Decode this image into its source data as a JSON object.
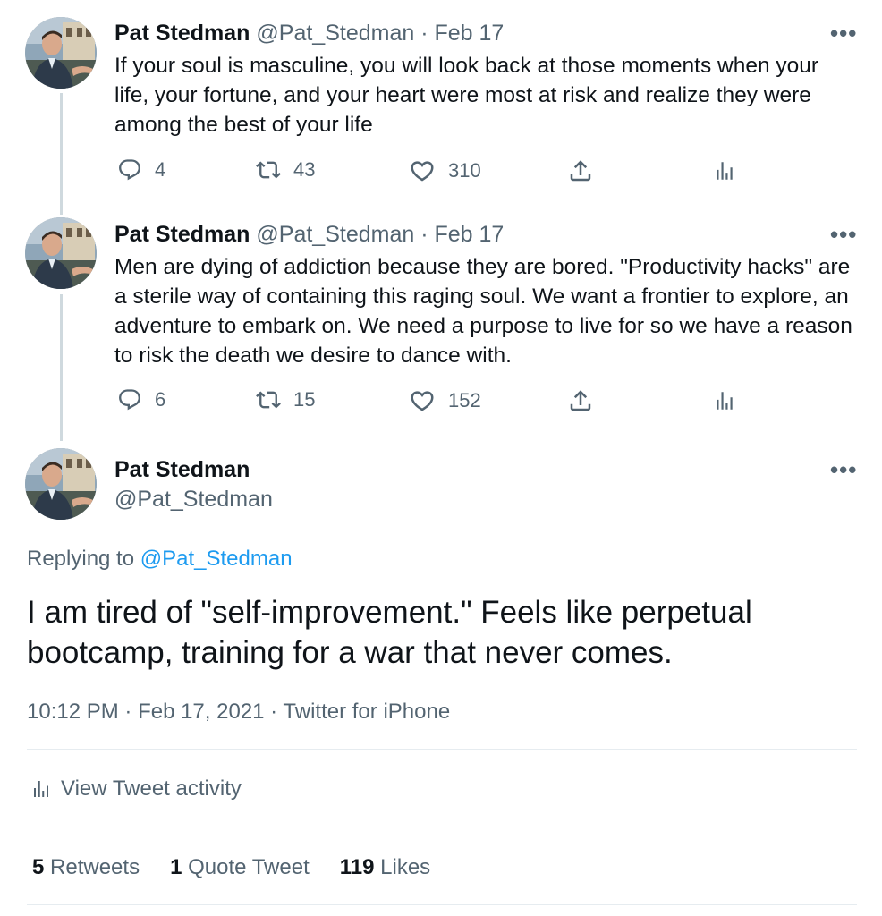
{
  "tweets": [
    {
      "name": "Pat Stedman",
      "handle": "@Pat_Stedman",
      "sep": " · ",
      "date": "Feb 17",
      "text": "If your soul is masculine, you will look back at those moments when your life, your fortune, and your heart were most at risk and realize they were among the best of your life",
      "replies": "4",
      "retweets": "43",
      "likes": "310"
    },
    {
      "name": "Pat Stedman",
      "handle": "@Pat_Stedman",
      "sep": " · ",
      "date": "Feb 17",
      "text": "Men are dying of addiction because they are bored. \"Productivity hacks\" are a sterile way of containing this raging soul. We want a frontier to explore, an adventure to embark on. We need a purpose to live for so we have a reason to risk the death we desire to dance with.",
      "replies": "6",
      "retweets": "15",
      "likes": "152"
    }
  ],
  "main": {
    "name": "Pat Stedman",
    "handle": "@Pat_Stedman",
    "replying_prefix": "Replying to ",
    "replying_handle": "@Pat_Stedman",
    "text": "I am tired of \"self-improvement.\" Feels like perpetual bootcamp, training for a war that never comes.",
    "time": "10:12 PM",
    "sep": " · ",
    "date": "Feb 17, 2021",
    "source": "Twitter for iPhone",
    "activity_label": "View Tweet activity",
    "stats": {
      "retweets_count": "5",
      "retweets_label": "Retweets",
      "quotes_count": "1",
      "quotes_label": "Quote Tweet",
      "likes_count": "119",
      "likes_label": "Likes"
    }
  },
  "more_glyph": "•••",
  "icons": {
    "avatar": "profile-photo",
    "reply": "reply-icon",
    "retweet": "retweet-icon",
    "like": "heart-icon",
    "share": "share-icon",
    "analytics": "analytics-icon"
  },
  "colors": {
    "link": "#1d9bf0",
    "secondary_text": "#536471",
    "thread_line": "#cfd9de"
  }
}
